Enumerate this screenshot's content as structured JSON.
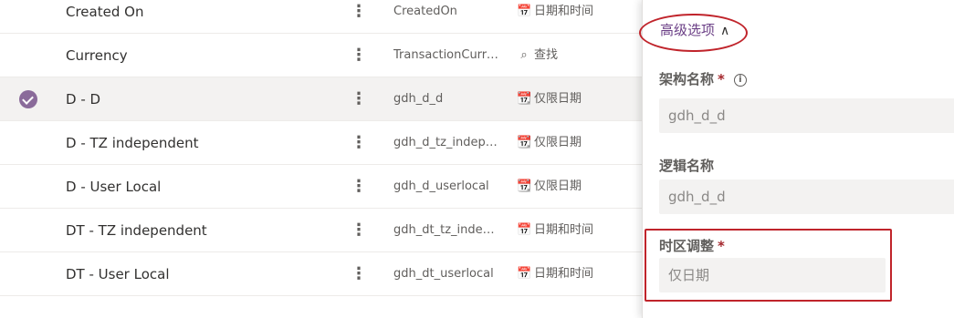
{
  "grid": {
    "rows": [
      {
        "name": "Created On",
        "schema": "CreatedOn",
        "type_icon": "calendar-clock-icon",
        "type_glyph": "📅",
        "type": "日期和时间",
        "selected": false
      },
      {
        "name": "Currency",
        "schema": "TransactionCurre...",
        "type_icon": "search-icon",
        "type_glyph": "⌕",
        "type": "查找",
        "selected": false
      },
      {
        "name": "D - D",
        "schema": "gdh_d_d",
        "type_icon": "calendar-icon",
        "type_glyph": "📆",
        "type": "仅限日期",
        "selected": true
      },
      {
        "name": "D - TZ independent",
        "schema": "gdh_d_tz_indepe...",
        "type_icon": "calendar-icon",
        "type_glyph": "📆",
        "type": "仅限日期",
        "selected": false
      },
      {
        "name": "D - User Local",
        "schema": "gdh_d_userlocal",
        "type_icon": "calendar-icon",
        "type_glyph": "📆",
        "type": "仅限日期",
        "selected": false
      },
      {
        "name": "DT - TZ independent",
        "schema": "gdh_dt_tz_indep...",
        "type_icon": "calendar-clock-icon",
        "type_glyph": "📅",
        "type": "日期和时间",
        "selected": false
      },
      {
        "name": "DT - User Local",
        "schema": "gdh_dt_userlocal",
        "type_icon": "calendar-clock-icon",
        "type_glyph": "📅",
        "type": "日期和时间",
        "selected": false
      }
    ],
    "more_glyph": "⋮"
  },
  "panel": {
    "advanced_label": "高级选项",
    "chevron_glyph": "∧",
    "schema_name": {
      "label": "架构名称",
      "required": "*",
      "info_glyph": "i",
      "value": "gdh_d_d"
    },
    "logical_name": {
      "label": "逻辑名称",
      "value": "gdh_d_d"
    },
    "timezone": {
      "label": "时区调整",
      "required": "*",
      "value": "仅日期"
    }
  },
  "colors": {
    "accent": "#6b3f86",
    "highlight": "#c0242b",
    "selected_row": "#f3f2f1"
  }
}
